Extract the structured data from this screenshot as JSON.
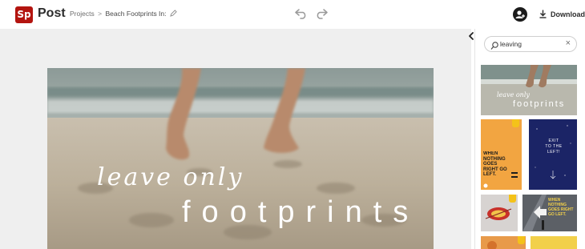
{
  "app": {
    "logo_text": "Sp",
    "name": "Post"
  },
  "breadcrumb": {
    "projects_label": "Projects",
    "separator": ">",
    "current": "Beach Footprints In:"
  },
  "toolbar": {
    "download_label": "Download"
  },
  "artboard": {
    "script_text": "leave only",
    "main_text": "footprints"
  },
  "search": {
    "value": "leaving"
  },
  "templates": [
    {
      "text_top": "leave only",
      "text_main": "footprints"
    },
    {
      "text": "WHEN NOTHING GOES RIGHT GO LEFT."
    },
    {
      "text": "EXIT TO THE LEFT!"
    },
    {
      "text": ""
    },
    {
      "text": "WHEN NOTHING GOES RIGHT GO LEFT."
    },
    {
      "text": ""
    },
    {
      "text": ""
    }
  ],
  "colors": {
    "brand": "#b3140f",
    "badge": "#f4c21a",
    "orange": "#f2a541",
    "navy": "#1b2466",
    "yellow": "#f2d04a"
  }
}
